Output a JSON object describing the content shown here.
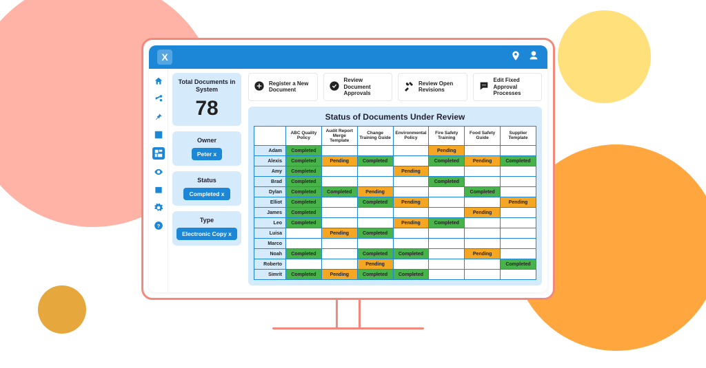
{
  "decor": {
    "colors": {
      "pink": "#FFB3A7",
      "yellow": "#FFE07A",
      "orange": "#FFA63F",
      "gold": "#E6A73C",
      "frame": "#F1897D",
      "brand": "#1B87D6"
    }
  },
  "header": {
    "logo_letter": "X",
    "icons": [
      "pin-icon",
      "user-icon"
    ]
  },
  "sidebar_icons": [
    {
      "name": "home-icon",
      "glyph": "home"
    },
    {
      "name": "share-icon",
      "glyph": "share"
    },
    {
      "name": "pin-icon",
      "glyph": "pin"
    },
    {
      "name": "check-icon",
      "glyph": "check",
      "boxed": true
    },
    {
      "name": "dashboard-icon",
      "glyph": "grid",
      "active": true
    },
    {
      "name": "eye-icon",
      "glyph": "eye"
    },
    {
      "name": "calendar-icon",
      "glyph": "calendar"
    },
    {
      "name": "gear-icon",
      "glyph": "gear"
    },
    {
      "name": "help-icon",
      "glyph": "help"
    }
  ],
  "cards": {
    "total": {
      "title": "Total Documents in System",
      "value": "78"
    },
    "owner": {
      "title": "Owner",
      "chip": "Peter x"
    },
    "status": {
      "title": "Status",
      "chip": "Completed x"
    },
    "type": {
      "title": "Type",
      "chip": "Electronic Copy x"
    }
  },
  "actions": [
    {
      "name": "add-icon",
      "label": "Register a New Document"
    },
    {
      "name": "check-circle-icon",
      "label": "Review Document Approvals"
    },
    {
      "name": "tools-icon",
      "label": "Review Open Revisions"
    },
    {
      "name": "chat-icon",
      "label": "Edit Fixed Approval Processes"
    }
  ],
  "panel": {
    "title": "Status of Documents Under Review",
    "columns": [
      "ABC Quality Policy",
      "Audit Report Merge Template",
      "Change Training Guide",
      "Environmental Policy",
      "Fire Safety Training",
      "Food Safety Guide",
      "Supplier Template"
    ],
    "rows": [
      {
        "name": "Adam",
        "cells": [
          "Completed",
          "",
          "",
          "",
          "Pending",
          "",
          ""
        ]
      },
      {
        "name": "Alexis",
        "cells": [
          "Completed",
          "Pending",
          "Completed",
          "",
          "Completed",
          "Pending",
          "Completed"
        ]
      },
      {
        "name": "Amy",
        "cells": [
          "Completed",
          "",
          "",
          "Pending",
          "",
          "",
          ""
        ]
      },
      {
        "name": "Brad",
        "cells": [
          "Completed",
          "",
          "",
          "",
          "Completed",
          "",
          ""
        ]
      },
      {
        "name": "Dylan",
        "cells": [
          "Completed",
          "Completed",
          "Pending",
          "",
          "",
          "Completed",
          ""
        ]
      },
      {
        "name": "Elliot",
        "cells": [
          "Completed",
          "",
          "Completed",
          "Pending",
          "",
          "",
          "Pending"
        ]
      },
      {
        "name": "James",
        "cells": [
          "Completed",
          "",
          "",
          "",
          "",
          "Pending",
          ""
        ]
      },
      {
        "name": "Leo",
        "cells": [
          "Completed",
          "",
          "",
          "Pending",
          "Completed",
          "",
          ""
        ]
      },
      {
        "name": "Luisa",
        "cells": [
          "",
          "Pending",
          "Completed",
          "",
          "",
          "",
          ""
        ]
      },
      {
        "name": "Marco",
        "cells": [
          "",
          "",
          "",
          "",
          "",
          "",
          ""
        ]
      },
      {
        "name": "Noah",
        "cells": [
          "Completed",
          "",
          "Completed",
          "Completed",
          "",
          "Pending",
          ""
        ]
      },
      {
        "name": "Roberto",
        "cells": [
          "",
          "",
          "Pending",
          "",
          "",
          "",
          "Completed"
        ]
      },
      {
        "name": "Simrit",
        "cells": [
          "Completed",
          "Pending",
          "Completed",
          "Completed",
          "",
          "",
          ""
        ]
      }
    ]
  }
}
